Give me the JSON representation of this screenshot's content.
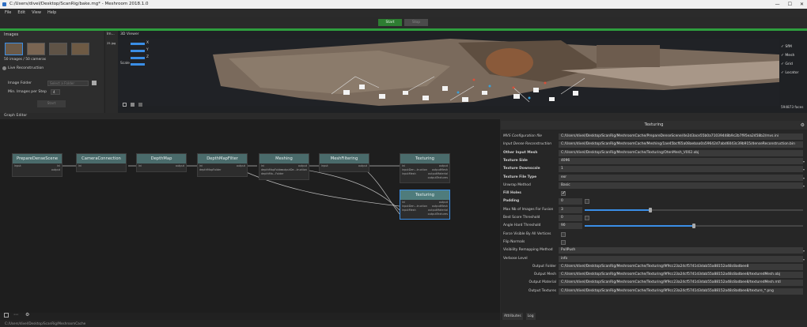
{
  "window": {
    "title": "C:/Users/divel/Desktop/ScanRig/bake.mg* - Meshroom 2018.1.0",
    "min": "—",
    "max": "☐",
    "close": "✕"
  },
  "menu": [
    "File",
    "Edit",
    "View",
    "Help"
  ],
  "toolbar": {
    "start_label": "Start",
    "stop_label": "Stop"
  },
  "images_panel": {
    "title": "Images",
    "count_label": "50 images / 50 cameras",
    "live_reconstruction_label": "Live Reconstruction",
    "image_folder_label": "Image Folder",
    "image_folder_placeholder": "Select a Folder",
    "min_images_label": "Min. Images per Step",
    "min_images_value": "4",
    "start_label": "Start"
  },
  "image_preview": {
    "title": "Im...",
    "filename": "25.jpg"
  },
  "viewer": {
    "title": "3D Viewer",
    "axes": [
      "X",
      "Y",
      "Z"
    ],
    "scale_label": "Scale",
    "faces_label": "594873 faces",
    "layers": [
      "SfM",
      "Mesh",
      "Grid",
      "Locator"
    ]
  },
  "graph_editor": {
    "title": "Graph Editor",
    "nodes": [
      {
        "label": "PrepareDenseScene",
        "inputs": [
          "input"
        ],
        "outputs": [
          "ini",
          "output"
        ]
      },
      {
        "label": "CameraConnection",
        "inputs": [
          "ini"
        ],
        "outputs": []
      },
      {
        "label": "DepthMap",
        "inputs": [
          "ini"
        ],
        "outputs": [
          "output"
        ]
      },
      {
        "label": "DepthMapFilter",
        "inputs": [
          "ini",
          "depthMapFolder"
        ],
        "outputs": [
          "output"
        ]
      },
      {
        "label": "Meshing",
        "inputs": [
          "ini",
          "depthMapFolder",
          "depthMa...Folder"
        ],
        "outputs": [
          "output",
          "outputDe...truction"
        ]
      },
      {
        "label": "MeshFiltering",
        "inputs": [
          "input"
        ],
        "outputs": [
          "output"
        ]
      },
      {
        "label": "Texturing",
        "inputs": [
          "ini",
          "inputDen...truction",
          "inputMesh"
        ],
        "outputs": [
          "output",
          "outputMesh",
          "outputMaterial",
          "outputTextures"
        ]
      },
      {
        "label": "Texturing",
        "inputs": [
          "ini",
          "inputDen...truction",
          "inputMesh"
        ],
        "outputs": [
          "output",
          "outputMesh",
          "outputMaterial",
          "outputTextures"
        ]
      }
    ],
    "footer_path": "C:/Users/divel/Desktop/ScanRig/MeshroomCache"
  },
  "attribute_editor": {
    "title": "Texturing",
    "rows": [
      {
        "label": "MVS Configuration file",
        "value": "C:/Users/divel/Desktop/ScanRig/MeshroomCache/PrepareDenseScene/4e2d3ace55b0a71039448b9c2b7f95ea2458b2/mvs.ini",
        "style": "ital"
      },
      {
        "label": "Input Dense Reconstruction",
        "value": "C:/Users/divel/Desktop/ScanRig/MeshroomCache/Meshing/1ae45bcf65a08aebaa0a59642d7abd6043c39b915/denseReconstruction.bin",
        "style": "ital"
      },
      {
        "label": "Other Input Mesh",
        "value": "C:/Users/divel/Desktop/ScanRig/MeshroomCache/Texturing/OtenMesh_V002.obj",
        "style": "bold"
      },
      {
        "label": "Texture Side",
        "value": "4096",
        "style": "bold"
      },
      {
        "label": "Texture Downscale",
        "value": "1",
        "style": "bold"
      },
      {
        "label": "Texture File Type",
        "value": "exr",
        "style": "bold"
      },
      {
        "label": "Unwrap Method",
        "value": "Basic",
        "style": ""
      },
      {
        "label": "Fill Holes",
        "value": "",
        "style": "bold"
      },
      {
        "label": "Padding",
        "value": "0",
        "style": "bold"
      },
      {
        "label": "Max Nb of Images For Fusion",
        "value": "3",
        "style": ""
      },
      {
        "label": "Best Score Threshold",
        "value": "0",
        "style": ""
      },
      {
        "label": "Angle Hard Threshold",
        "value": "90",
        "style": ""
      },
      {
        "label": "Force Visible By All Vertices",
        "value": "",
        "style": ""
      },
      {
        "label": "Flip Normals",
        "value": "",
        "style": ""
      },
      {
        "label": "Visibility Remapping Method",
        "value": "PullPush",
        "style": ""
      },
      {
        "label": "Verbose Level",
        "value": "info",
        "style": ""
      },
      {
        "label": "Output Folder",
        "value": "C:/Users/divel/Desktop/ScanRig/MeshroomCache/Texturing/9f9cc23a24cf5741d3dab55a88152a48c8adbee8",
        "style": "right"
      },
      {
        "label": "Output Mesh",
        "value": "C:/Users/divel/Desktop/ScanRig/MeshroomCache/Texturing/9f9cc23a24cf5741d3dab55a88152a48c8adbee8/texturedMesh.obj",
        "style": "right"
      },
      {
        "label": "Output Material",
        "value": "C:/Users/divel/Desktop/ScanRig/MeshroomCache/Texturing/9f9cc23a24cf5741d3dab55a88152a48c8adbee8/texturedMesh.mtl",
        "style": "right"
      },
      {
        "label": "Output Textures",
        "value": "C:/Users/divel/Desktop/ScanRig/MeshroomCache/Texturing/9f9cc23a24cf5741d3dab55a88152a48c8adbee8/texture_*.png",
        "style": "right"
      }
    ],
    "tabs": [
      "Attributes",
      "Log"
    ],
    "fill_holes_checked": true,
    "max_images_fraction": 0.3,
    "angle_fraction": 0.5
  },
  "colors": {
    "accent": "#3a8ee6",
    "node_header": "#4a6b6b",
    "progress": "#2e9e3e",
    "start": "#2e7d32"
  }
}
